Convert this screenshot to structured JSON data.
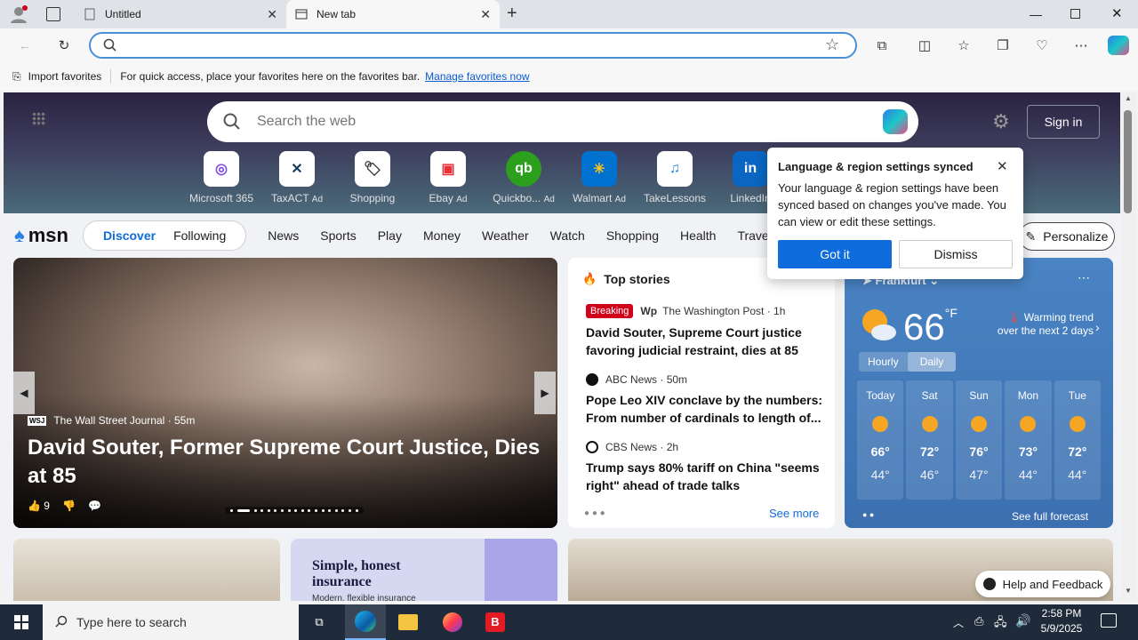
{
  "browser": {
    "tabs": [
      {
        "title": "Untitled"
      },
      {
        "title": "New tab"
      }
    ],
    "address_placeholder": "",
    "favorites_bar": {
      "import_label": "Import favorites",
      "message": "For quick access, place your favorites here on the favorites bar.",
      "link": "Manage favorites now"
    }
  },
  "msn": {
    "search_placeholder": "Search the web",
    "sign_in": "Sign in",
    "quicklinks": [
      {
        "label": "Microsoft 365",
        "ad": ""
      },
      {
        "label": "TaxACT",
        "ad": "Ad"
      },
      {
        "label": "Shopping",
        "ad": ""
      },
      {
        "label": "Ebay",
        "ad": "Ad"
      },
      {
        "label": "Quickbo...",
        "ad": "Ad"
      },
      {
        "label": "Walmart",
        "ad": "Ad"
      },
      {
        "label": "TakeLessons",
        "ad": ""
      },
      {
        "label": "LinkedIn",
        "ad": ""
      }
    ],
    "logo": "msn",
    "nav": {
      "discover": "Discover",
      "following": "Following",
      "items": [
        "News",
        "Sports",
        "Play",
        "Money",
        "Weather",
        "Watch",
        "Shopping",
        "Health",
        "Travel"
      ],
      "personalize": "Personalize"
    },
    "hero": {
      "source": "The Wall Street Journal",
      "time": "55m",
      "title": "David Souter, Former Supreme Court Justice, Dies at 85",
      "likes": "9"
    },
    "top_stories": {
      "header": "Top stories",
      "stories": [
        {
          "badge": "Breaking",
          "source": "The Washington Post",
          "time": "1h",
          "headline": "David Souter, Supreme Court justice favoring judicial restraint, dies at 85"
        },
        {
          "badge": "",
          "source": "ABC News",
          "time": "50m",
          "headline": "Pope Leo XIV conclave by the numbers: From number of cardinals to length of..."
        },
        {
          "badge": "",
          "source": "CBS News",
          "time": "2h",
          "headline": "Trump says 80% tariff on China \"seems right\" ahead of trade talks"
        }
      ],
      "see_more": "See more"
    },
    "weather": {
      "location": "Frankfurt",
      "temp": "66",
      "unit": "°F",
      "trend": "Warming trend over the next 2 days",
      "tabs": [
        "Hourly",
        "Daily"
      ],
      "days": [
        {
          "day": "Today",
          "hi": "66°",
          "lo": "44°"
        },
        {
          "day": "Sat",
          "hi": "72°",
          "lo": "46°"
        },
        {
          "day": "Sun",
          "hi": "76°",
          "lo": "47°"
        },
        {
          "day": "Mon",
          "hi": "73°",
          "lo": "44°"
        },
        {
          "day": "Tue",
          "hi": "72°",
          "lo": "44°"
        }
      ],
      "full_forecast": "See full forecast"
    },
    "popup": {
      "title": "Language & region settings synced",
      "body": "Your language & region settings have been synced based on changes you've made. You can view or edit these settings.",
      "got_it": "Got it",
      "dismiss": "Dismiss"
    },
    "ad_card": {
      "title": "Simple, honest insurance",
      "sub": "Modern, flexible insurance"
    },
    "help": "Help and Feedback"
  },
  "taskbar": {
    "search_placeholder": "Type here to search",
    "time": "2:58 PM",
    "date": "5/9/2025"
  },
  "colors": {
    "accent": "#0f6cdd",
    "breaking": "#d0021b",
    "weather_bg": "#4a84c4"
  }
}
